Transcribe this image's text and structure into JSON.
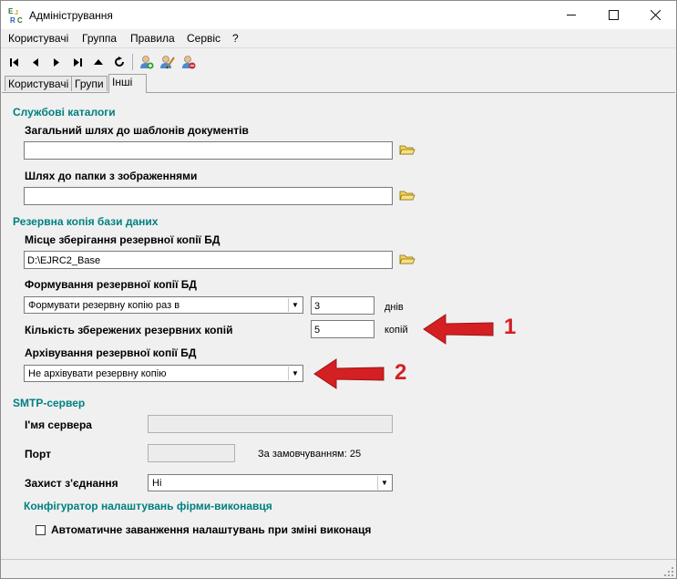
{
  "window": {
    "title": "Адміністрування",
    "minimize_icon": "minimize-icon",
    "maximize_icon": "maximize-icon",
    "close_icon": "close-icon"
  },
  "menu": [
    {
      "label": "Користувачі"
    },
    {
      "label": "Группа"
    },
    {
      "label": "Правила"
    },
    {
      "label": "Сервіс"
    },
    {
      "label": "?"
    }
  ],
  "toolbar": {
    "buttons": [
      "first-record-icon",
      "prev-record-icon",
      "next-record-icon",
      "last-record-icon",
      "up-icon",
      "refresh-icon",
      "add-user-icon",
      "edit-user-icon",
      "delete-user-icon"
    ]
  },
  "tabs": [
    {
      "label": "Користувачі"
    },
    {
      "label": "Групи"
    },
    {
      "label": "Інші",
      "active": true
    }
  ],
  "service_dirs": {
    "heading": "Службові каталоги",
    "templates_label": "Загальний шлях до шаблонів документів",
    "templates_value": "",
    "images_label": "Шлях до папки з зображеннями",
    "images_value": ""
  },
  "backup": {
    "heading": "Резервна копія бази даних",
    "location_label": "Місце зберігання резервної копії БД",
    "location_value": "D:\\EJRC2_Base",
    "schedule_label": "Формування резервної копії БД",
    "schedule_selected": "Формувати резервну копію раз в",
    "schedule_days": "3",
    "days_unit": "днів",
    "count_label": "Кількість збережених резервних копій",
    "count_value": "5",
    "count_unit": "копій",
    "archive_label": "Архівування резервної копії БД",
    "archive_selected": "Не архівувати резервну копію"
  },
  "smtp": {
    "heading": "SMTP-сервер",
    "server_label": "І'мя сервера",
    "server_value": "",
    "port_label": "Порт",
    "port_value": "",
    "port_default_note": "За замовчуванням: 25",
    "security_label": "Захист з'єднання",
    "security_selected": "Ні"
  },
  "configurator": {
    "heading": "Конфігуратор налаштувань фірми-виконавця",
    "auto_load_label": "Автоматичне заванження налаштувань при зміні виконаця",
    "auto_load_checked": false
  },
  "annotations": {
    "arrow1": "1",
    "arrow2": "2",
    "color": "#d41f23"
  },
  "colors": {
    "section_heading": "#008080",
    "window_bg": "#f0f0f0"
  }
}
